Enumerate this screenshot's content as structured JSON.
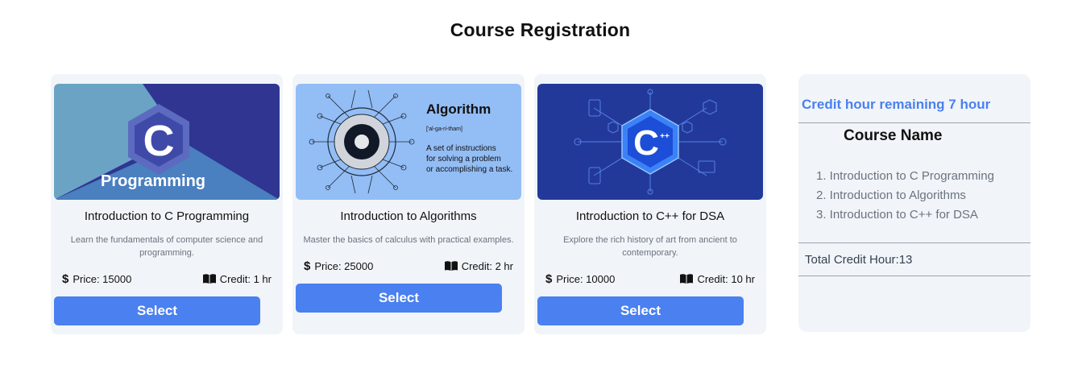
{
  "page": {
    "title": "Course Registration"
  },
  "courses": [
    {
      "title": "Introduction to C Programming",
      "description": "Learn the fundamentals of computer science and programming.",
      "price_label": "Price: 15000",
      "credit_label": "Credit: 1 hr",
      "select_label": "Select",
      "image_text": "Programming",
      "image_letter": "C"
    },
    {
      "title": "Introduction to Algorithms",
      "description": "Master the basics of calculus with practical examples.",
      "price_label": "Price: 25000",
      "credit_label": "Credit: 2 hr",
      "select_label": "Select",
      "image_heading": "Algorithm",
      "image_phonetic": "['al-ga-ri-tham]",
      "image_line1": "A set of instructions",
      "image_line2": "for solving a problem",
      "image_line3": "or accomplishing a task."
    },
    {
      "title": "Introduction to C++ for DSA",
      "description": "Explore the rich history of art from ancient to contemporary.",
      "price_label": "Price: 10000",
      "credit_label": "Credit: 10 hr",
      "select_label": "Select",
      "image_letter": "C",
      "image_plus": "++"
    }
  ],
  "summary": {
    "remaining": "Credit hour remaining 7 hour",
    "list_title": "Course Name",
    "items": [
      "1. Introduction to C Programming",
      "2. Introduction to Algorithms",
      "3. Introduction to C++ for DSA"
    ],
    "total": "Total Credit Hour:13"
  },
  "icons": {
    "price": "dollar-icon",
    "credit": "book-icon"
  },
  "colors": {
    "accent": "#4a80f0",
    "card_bg": "#f1f5f9",
    "muted_text": "#6b7280"
  }
}
